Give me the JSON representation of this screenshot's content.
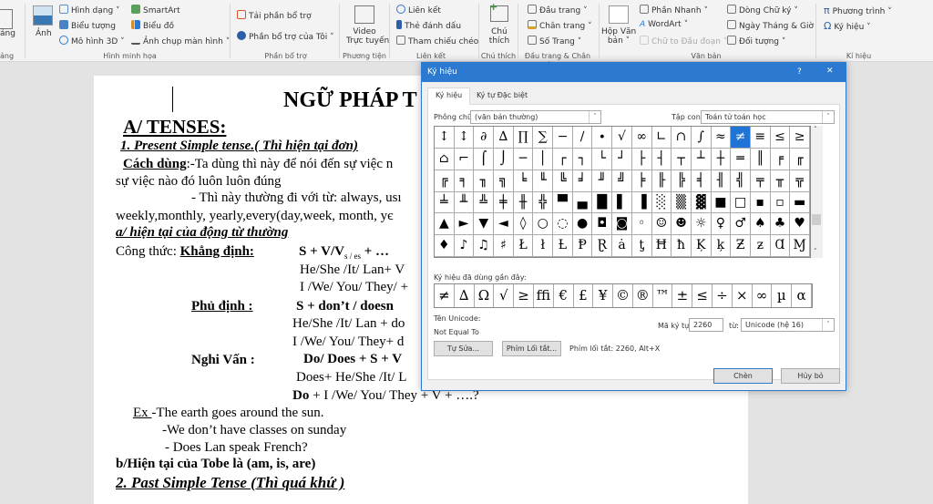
{
  "ribbon": {
    "table_partial": "ảng",
    "table_group_partial": "ảng",
    "illustrations": {
      "picture": "Ảnh",
      "shapes": "Hình dạng",
      "icons": "Biểu tượng",
      "models3d": "Mô hình 3D",
      "smartart": "SmartArt",
      "chart": "Biểu đồ",
      "screenshot": "Ảnh chụp màn hình",
      "group": "Hình minh họa"
    },
    "addins": {
      "get": "Tải phần bổ trợ",
      "my": "Phần bổ trợ của Tôi",
      "group": "Phần bổ trợ"
    },
    "media": {
      "video_line1": "Video",
      "video_line2": "Trực tuyến",
      "group": "Phương tiện"
    },
    "links": {
      "link": "Liên kết",
      "bookmark": "Thẻ đánh dấu",
      "crossref": "Tham chiếu chéo",
      "group": "Liên kết"
    },
    "comments": {
      "comment_line1": "Chú",
      "comment_line2": "thích",
      "group": "Chú thích"
    },
    "headerfooter": {
      "header": "Đầu trang",
      "footer": "Chân trang",
      "pagenum": "Số Trang",
      "group": "Đầu trang & Chân trang"
    },
    "text": {
      "textbox_line1": "Hộp Văn",
      "textbox_line2": "bản",
      "quickparts": "Phần Nhanh",
      "wordart": "WordArt",
      "dropcap": "Chữ to Đầu đoạn",
      "signature": "Dòng Chữ ký",
      "datetime": "Ngày Tháng & Giờ",
      "object": "Đối tượng",
      "group": "Văn bản"
    },
    "symbols": {
      "equation": "Phương trình",
      "symbol": "Ký hiệu",
      "group": "Kí hiệu"
    }
  },
  "document": {
    "title": "NGỮ PHÁP T",
    "lines": [
      "A/ TENSES:",
      "1. Present Simple tense.( Thì hiện tại đơn)",
      "Cách dùng",
      ":-Ta dùng thì này để nói đến sự việc n",
      "sự việc nào đó luôn luôn đúng",
      "- Thì này thường đi với từ: always, usı",
      "weekly,monthly, yearly,every(day,week, month, yє",
      "a/ hiện tại của động từ thường",
      "Công thức: ",
      "Khẳng định:",
      "S + V/V",
      "s / es",
      " +  …",
      "He/She /It/ Lan+ V",
      "I /We/ You/ They/  +",
      "Phủ định :",
      "S + don’t /  doesn",
      "He/She /It/ Lan +  do",
      "I /We/ You/ They+  d",
      "Nghi Vấn  :",
      "Do/ Does + S + V",
      "Does+  He/She /It/ L",
      "Do",
      " + I /We/ You/ They +  V + ….?",
      "Ex ",
      "-The earth goes around the sun.",
      "-We don’t have classes on sunday",
      "- Does Lan speak French?",
      "b/Hiện tại của Tobe là (am, is, are)",
      "2. Past Simple Tense (Thì quá khứ )"
    ]
  },
  "dialog": {
    "title": "Ký hiệu",
    "help": "?",
    "close": "✕",
    "tabs": [
      "Ký hiệu",
      "Ký tự Đặc biệt"
    ],
    "font_label": "Phông chữ:",
    "font_value": "(văn bản thường)",
    "subset_label": "Tập con:",
    "subset_value": "Toán tử toán học",
    "selected_index": 15,
    "symbols": [
      "↕",
      "↕",
      "∂",
      "∆",
      "∏",
      "∑",
      "−",
      "∕",
      "∙",
      "√",
      "∞",
      "∟",
      "∩",
      "∫",
      "≈",
      "≠",
      "≡",
      "≤",
      "≥",
      "⌂",
      "⌐",
      "⌠",
      "⌡",
      "─",
      "│",
      "┌",
      "┐",
      "└",
      "┘",
      "├",
      "┤",
      "┬",
      "┴",
      "┼",
      "═",
      "║",
      "╒",
      "╓",
      "╔",
      "╕",
      "╖",
      "╗",
      "╘",
      "╙",
      "╚",
      "╛",
      "╜",
      "╝",
      "╞",
      "╟",
      "╠",
      "╡",
      "╢",
      "╣",
      "╤",
      "╥",
      "╦",
      "╧",
      "╨",
      "╩",
      "╪",
      "╫",
      "╬",
      "▀",
      "▄",
      "█",
      "▌",
      "▐",
      "░",
      "▒",
      "▓",
      "■",
      "□",
      "▪",
      "▫",
      "▬",
      "▲",
      "►",
      "▼",
      "◄",
      "◊",
      "○",
      "◌",
      "●",
      "◘",
      "◙",
      "◦",
      "☺",
      "☻",
      "☼",
      "♀",
      "♂",
      "♠",
      "♣",
      "♥",
      "♦",
      "♪",
      "♫",
      "♯",
      "Ł",
      "ł",
      "Ƚ",
      "Ᵽ",
      "Ɽ",
      "ȧ",
      "ƫ",
      "Ħ",
      "ħ",
      "Ķ",
      "ķ",
      "Ƶ",
      "ƶ",
      "Ɑ",
      "Ɱ"
    ],
    "recent_label": "Ký hiệu đã dùng gần đây:",
    "recent": [
      "≠",
      "∆",
      "Ω",
      "√",
      "≥",
      "ﬃ",
      "€",
      "£",
      "¥",
      "©",
      "®",
      "™",
      "±",
      "≤",
      "÷",
      "×",
      "∞",
      "µ",
      "α"
    ],
    "unicode_name_label": "Tên Unicode:",
    "unicode_name": "Not Equal To",
    "charcode_label": "Mã ký tự:",
    "charcode": "2260",
    "from_label": "từ:",
    "from_value": "Unicode (hệ 16)",
    "autocorrect": "Tự Sửa...",
    "shortcut_key": "Phím Lối tắt...",
    "shortcut_text": "Phím lối tắt: 2260, Alt+X",
    "insert": "Chèn",
    "cancel": "Hủy bỏ"
  },
  "colors": {
    "accent": "#2b79d0",
    "selected": "#1f74d6"
  }
}
